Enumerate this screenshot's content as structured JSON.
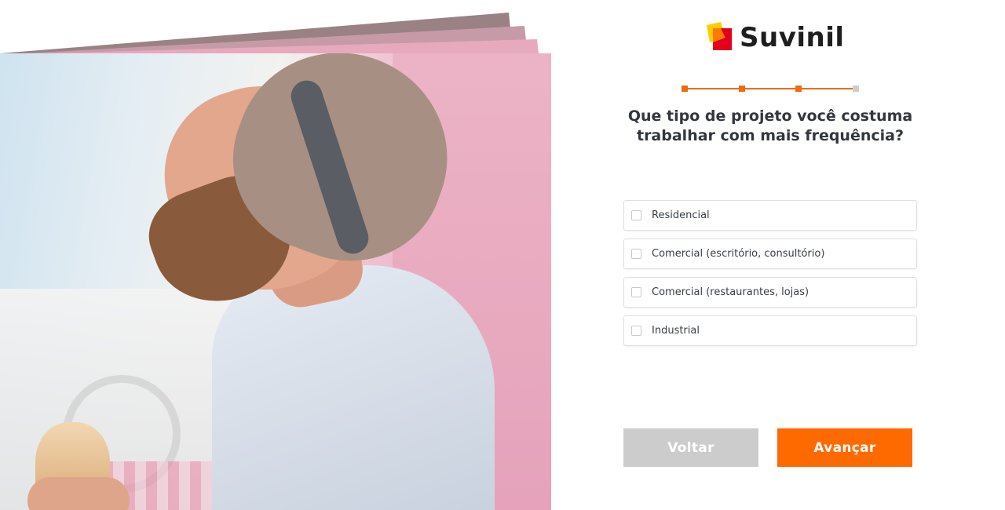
{
  "brand": {
    "name": "Suvinil",
    "accent": "#ff6a00"
  },
  "stepper": {
    "total_steps": 4,
    "current_step": 3,
    "active_color": "#f06a0f",
    "inactive_color": "#cccccc"
  },
  "question": {
    "line1": "Que tipo de projeto você costuma",
    "line2": "trabalhar com mais frequência?"
  },
  "options": [
    {
      "label": "Residencial",
      "checked": false
    },
    {
      "label": "Comercial (escritório, consultório)",
      "checked": false
    },
    {
      "label": "Comercial (restaurantes, lojas)",
      "checked": false
    },
    {
      "label": "Industrial",
      "checked": false
    }
  ],
  "buttons": {
    "back_label": "Voltar",
    "next_label": "Avançar"
  },
  "photo": {
    "description_icon": "man-with-hat-and-ice-cream-photo"
  }
}
